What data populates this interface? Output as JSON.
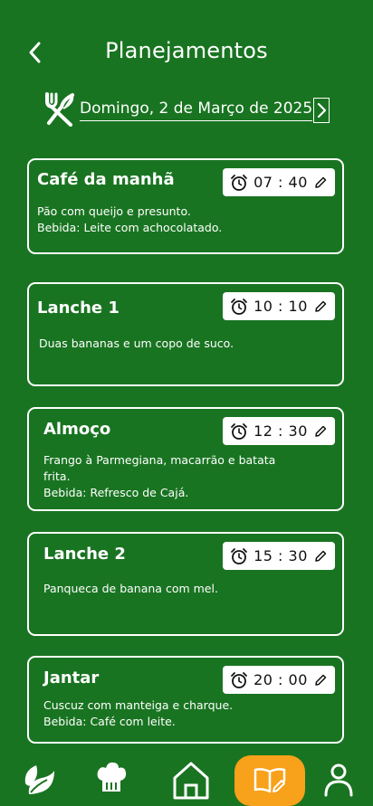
{
  "header": {
    "title": "Planejamentos",
    "back_icon": "chevron-left-icon"
  },
  "date_selector": {
    "label": "Domingo, 2 de Março de 2025",
    "icon": "fork-knife-icon",
    "next_icon": "chevron-right-icon"
  },
  "meals": [
    {
      "title": "Café da manhã",
      "time": "07 : 40",
      "lines": [
        "Pão com queijo e presunto.",
        "Bebida: Leite com achocolatado."
      ]
    },
    {
      "title": "Lanche 1",
      "time": "10 : 10",
      "lines": [
        "Duas bananas e um copo de suco."
      ]
    },
    {
      "title": "Almoço",
      "time": "12 : 30",
      "lines": [
        "Frango à Parmegiana, macarrão e batata",
        "frita.",
        "Bebida: Refresco de Cajá."
      ]
    },
    {
      "title": "Lanche 2",
      "time": "15 : 30",
      "lines": [
        "Panqueca de banana com mel."
      ]
    },
    {
      "title": "Jantar",
      "time": "20 : 00",
      "lines": [
        "Cuscuz com manteiga e charque.",
        "Bebida: Café com leite."
      ]
    }
  ],
  "nav": {
    "items": [
      "leaves-icon",
      "chef-hat-icon",
      "home-icon",
      "book-edit-icon",
      "user-icon"
    ],
    "active": "book-edit-icon"
  },
  "colors": {
    "background": "#197421",
    "accent": "#f8a11a",
    "card_border": "#ffffff"
  }
}
